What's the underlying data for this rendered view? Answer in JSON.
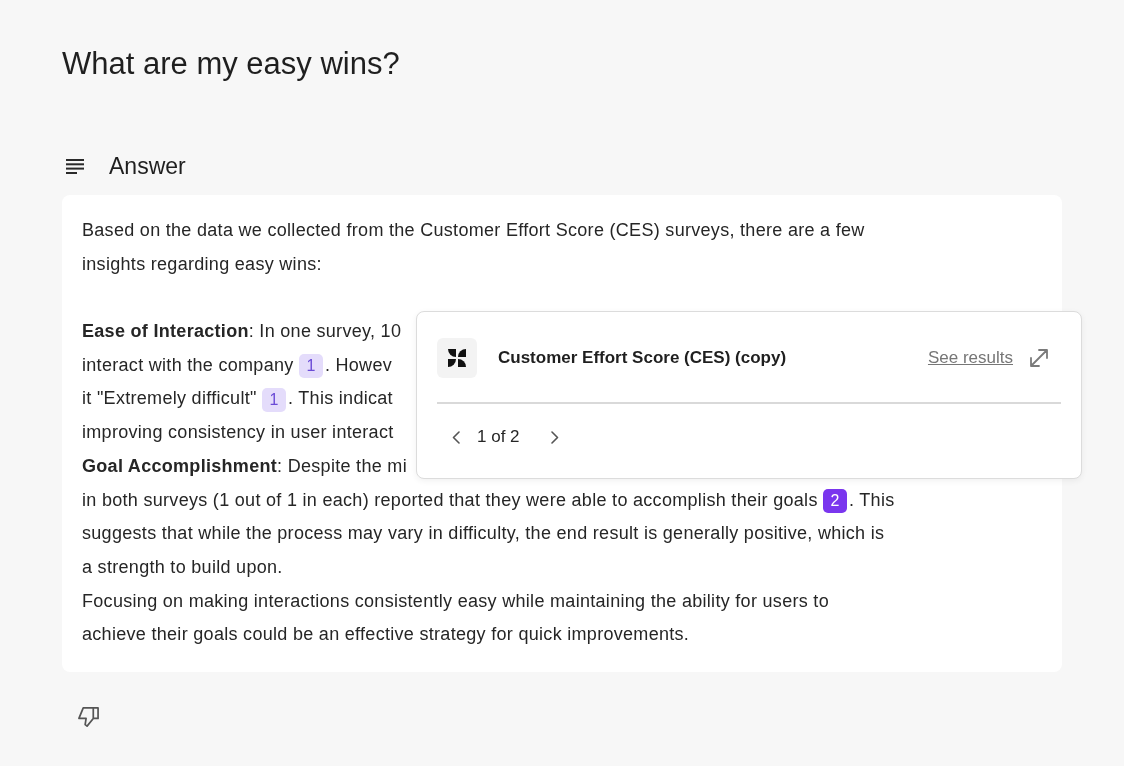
{
  "question": "What are my easy wins?",
  "answer": {
    "heading": "Answer",
    "paragraphs": [
      {
        "lines": [
          {
            "parts": [
              {
                "kind": "text",
                "text": "Based on the data we collected from the Customer Effort Score (CES) surveys, there are a few"
              }
            ]
          },
          {
            "parts": [
              {
                "kind": "text",
                "text": "insights regarding easy wins:"
              }
            ]
          }
        ]
      },
      {
        "lines": [
          {
            "parts": [
              {
                "kind": "text",
                "text": "**Ease of Interaction**: In one survey, 10"
              }
            ]
          },
          {
            "parts": [
              {
                "kind": "text",
                "text": "interact with the company "
              },
              {
                "kind": "citation",
                "label": "1",
                "selected": false
              },
              {
                "kind": "text",
                "text": ". Howev"
              }
            ]
          },
          {
            "parts": [
              {
                "kind": "text",
                "text": "it \"Extremely difficult\" "
              },
              {
                "kind": "citation",
                "label": "1",
                "selected": false
              },
              {
                "kind": "text",
                "text": ". This indicat"
              }
            ]
          },
          {
            "parts": [
              {
                "kind": "text",
                "text": "improving consistency in user interact"
              }
            ]
          },
          {
            "parts": [
              {
                "kind": "text",
                "text": "**Goal Accomplishment**: Despite the mi"
              }
            ]
          },
          {
            "parts": [
              {
                "kind": "text",
                "text": "in both surveys (1 out of 1 in each) reported that they were able to accomplish their goals "
              },
              {
                "kind": "citation",
                "label": "2",
                "selected": true
              },
              {
                "kind": "text",
                "text": ". This"
              }
            ]
          },
          {
            "parts": [
              {
                "kind": "text",
                "text": "suggests that while the process may vary in difficulty, the end result is generally positive, which is"
              }
            ]
          },
          {
            "parts": [
              {
                "kind": "text",
                "text": "a strength to build upon."
              }
            ]
          },
          {
            "parts": [
              {
                "kind": "text",
                "text": "Focusing on making interactions consistently easy while maintaining the ability for users to"
              }
            ]
          },
          {
            "parts": [
              {
                "kind": "text",
                "text": "achieve their goals could be an effective strategy for quick improvements."
              }
            ]
          }
        ]
      }
    ]
  },
  "source_popup": {
    "title": "Customer Effort Score (CES) (copy)",
    "link": "See results",
    "pager": "1 of 2"
  }
}
